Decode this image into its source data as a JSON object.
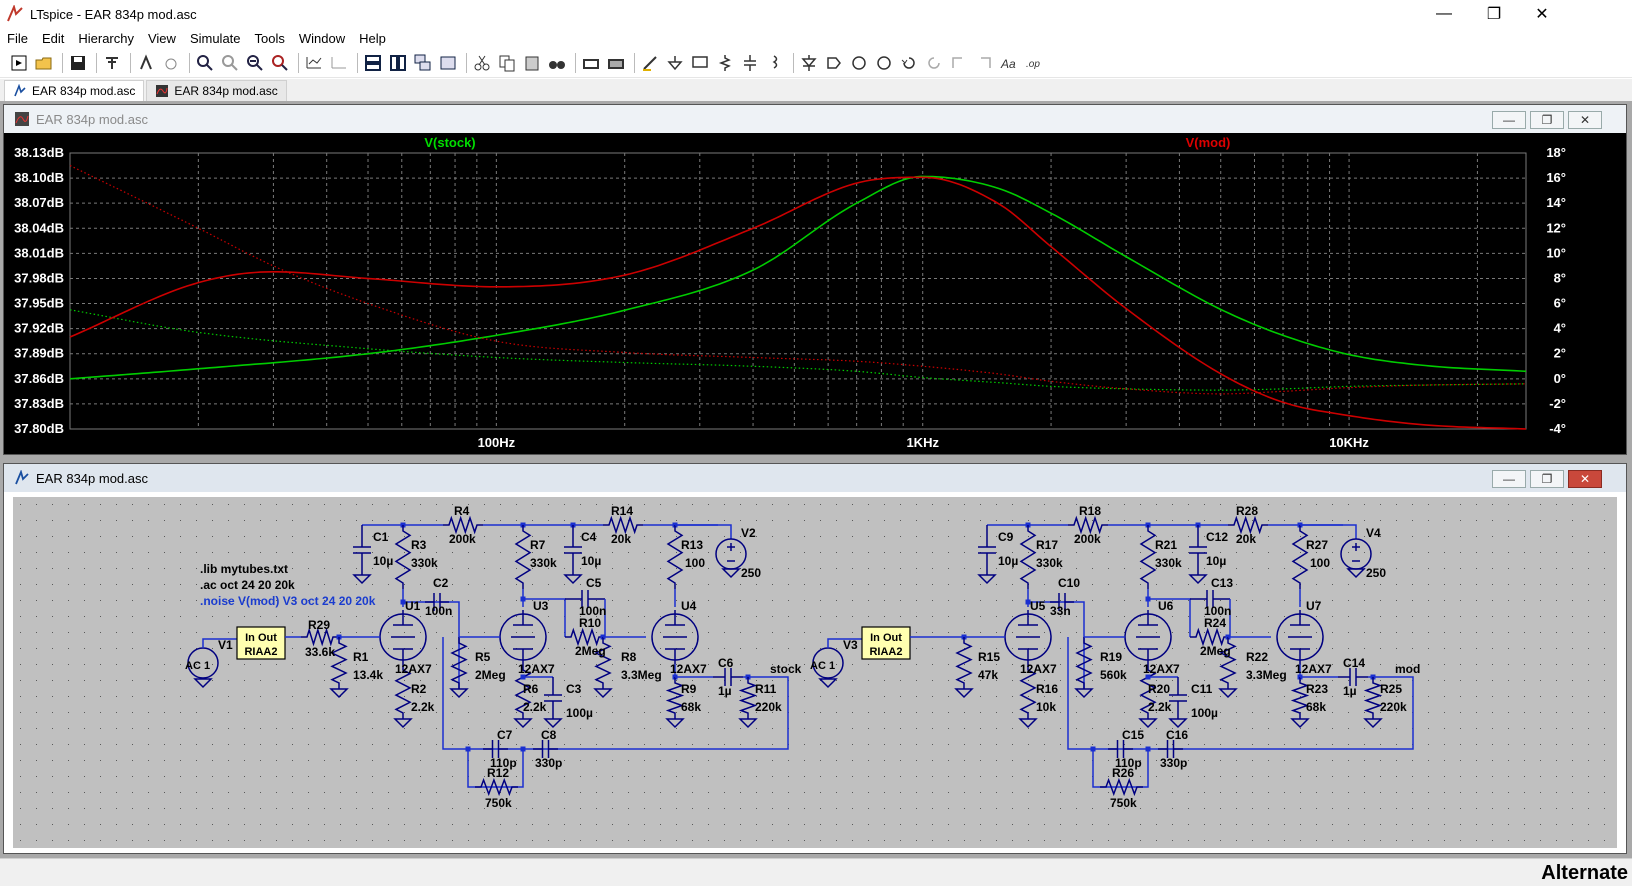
{
  "window": {
    "title": "LTspice - EAR 834p mod.asc",
    "minimize": "—",
    "maximize": "❐",
    "close": "✕"
  },
  "menu": [
    "File",
    "Edit",
    "Hierarchy",
    "View",
    "Simulate",
    "Tools",
    "Window",
    "Help"
  ],
  "tabs": [
    {
      "label": "EAR 834p mod.asc",
      "icon": "schematic-icon"
    },
    {
      "label": "EAR 834p mod.asc",
      "icon": "waveform-icon"
    }
  ],
  "plot_window": {
    "title": "EAR 834p mod.asc"
  },
  "schematic_window": {
    "title": "EAR 834p mod.asc"
  },
  "status": {
    "text": "Alternate"
  },
  "chart_data": {
    "type": "line",
    "x_scale": "log",
    "xlim": [
      10,
      26000
    ],
    "x_ticks": [
      {
        "value": 100,
        "label": "100Hz"
      },
      {
        "value": 1000,
        "label": "1KHz"
      },
      {
        "value": 10000,
        "label": "10KHz"
      }
    ],
    "ylim_left": [
      37.8,
      38.13
    ],
    "ylim_right": [
      -4,
      18
    ],
    "y_left_ticks": [
      "38.13dB",
      "38.10dB",
      "38.07dB",
      "38.04dB",
      "38.01dB",
      "37.98dB",
      "37.95dB",
      "37.92dB",
      "37.89dB",
      "37.86dB",
      "37.83dB",
      "37.80dB"
    ],
    "y_right_ticks": [
      "18°",
      "16°",
      "14°",
      "12°",
      "10°",
      "8°",
      "6°",
      "4°",
      "2°",
      "0°",
      "-2°",
      "-4°"
    ],
    "grid": true,
    "series": [
      {
        "name": "V(stock)",
        "color": "#00cc00",
        "label_color": "#00dd00",
        "x": [
          10,
          20,
          50,
          100,
          200,
          400,
          700,
          1000,
          1500,
          2000,
          3000,
          5000,
          7000,
          10000,
          15000,
          26000
        ],
        "magnitude_db": [
          37.86,
          37.872,
          37.89,
          37.912,
          37.942,
          37.99,
          38.07,
          38.102,
          38.088,
          38.058,
          38.006,
          37.943,
          37.912,
          37.889,
          37.876,
          37.869
        ],
        "phase_deg": [
          5.5,
          3.7,
          2.4,
          1.7,
          1.3,
          1.0,
          0.6,
          0.1,
          -0.3,
          -0.6,
          -0.8,
          -0.9,
          -0.8,
          -0.6,
          -0.5,
          -0.4
        ]
      },
      {
        "name": "V(mod)",
        "color": "#cc0000",
        "label_color": "#dd0000",
        "x": [
          10,
          20,
          30,
          50,
          100,
          200,
          400,
          700,
          1000,
          1500,
          2000,
          3000,
          5000,
          7000,
          10000,
          15000,
          26000
        ],
        "magnitude_db": [
          37.91,
          37.975,
          37.988,
          37.98,
          37.97,
          37.984,
          38.04,
          38.094,
          38.101,
          38.07,
          38.018,
          37.944,
          37.866,
          37.832,
          37.816,
          37.805,
          37.8
        ],
        "phase_deg": [
          17.0,
          12.0,
          9.0,
          6.0,
          3.0,
          2.1,
          1.7,
          1.4,
          1.0,
          0.4,
          -0.2,
          -0.8,
          -1.2,
          -1.0,
          -0.7,
          -0.5,
          -0.4
        ]
      }
    ]
  },
  "schematic": {
    "directives": [
      ".lib mytubes.txt",
      ".ac oct 24 20 20k",
      ".noise V(mod) V3 oct 24 20 20k"
    ],
    "left": {
      "labels": {
        "R4": "R4",
        "R4v": "200k",
        "R14": "R14",
        "R14v": "20k",
        "C1": "C1",
        "C1v": "10µ",
        "R3": "R3",
        "R3v": "330k",
        "R7": "R7",
        "R7v": "330k",
        "C4": "C4",
        "C4v": "10µ",
        "R13": "R13",
        "R13v": "100",
        "V2": "V2",
        "V2v": "250",
        "C2": "C2",
        "C2v": "100n",
        "C5": "C5",
        "C5v": "100n",
        "R10": "R10",
        "R10v": "2Meg",
        "U1": "U1",
        "U3": "U3",
        "U4": "U4",
        "V1": "V1",
        "AC": "AC 1",
        "riaa1": "In Out",
        "riaa2": "RIAA2",
        "R29": "R29",
        "R29v": "33.6k",
        "R1": "R1",
        "R1v": "13.4k",
        "T1": "12AX7",
        "T3": "12AX7",
        "T4": "12AX7",
        "R5": "R5",
        "R5v": "2Meg",
        "R8": "R8",
        "R8v": "3.3Meg",
        "C6": "C6",
        "C6v": "1µ",
        "out": "stock",
        "R2": "R2",
        "R2v": "2.2k",
        "R6": "R6",
        "R6v": "2.2k",
        "C3": "C3",
        "C3v": "100µ",
        "R9": "R9",
        "R9v": "68k",
        "R11": "R11",
        "R11v": "220k",
        "C7": "C7",
        "C7v": "110p",
        "C8": "C8",
        "C8v": "330p",
        "R12": "R12",
        "R12v": "750k"
      }
    },
    "right": {
      "labels": {
        "R4": "R18",
        "R4v": "200k",
        "R14": "R28",
        "R14v": "20k",
        "C1": "C9",
        "C1v": "10µ",
        "R3": "R17",
        "R3v": "330k",
        "R7": "R21",
        "R7v": "330k",
        "C4": "C12",
        "C4v": "10µ",
        "R13": "R27",
        "R13v": "100",
        "V2": "V4",
        "V2v": "250",
        "C2": "C10",
        "C2v": "33n",
        "C5": "C13",
        "C5v": "100n",
        "R10": "R24",
        "R10v": "2Meg",
        "U1": "U5",
        "U3": "U6",
        "U4": "U7",
        "V1": "V3",
        "AC": "AC 1",
        "riaa1": "In Out",
        "riaa2": "RIAA2",
        "R29": "",
        "R29v": "",
        "R1": "R15",
        "R1v": "47k",
        "T1": "12AX7",
        "T3": "12AX7",
        "T4": "12AX7",
        "R5": "R19",
        "R5v": "560k",
        "R8": "R22",
        "R8v": "3.3Meg",
        "C6": "C14",
        "C6v": "1µ",
        "out": "mod",
        "R2": "R16",
        "R2v": "10k",
        "R6": "R20",
        "R6v": "2.2k",
        "C3": "C11",
        "C3v": "100µ",
        "R9": "R23",
        "R9v": "68k",
        "R11": "R25",
        "R11v": "220k",
        "C7": "C15",
        "C7v": "110p",
        "C8": "C16",
        "C8v": "330p",
        "R12": "R26",
        "R12v": "750k"
      }
    }
  }
}
